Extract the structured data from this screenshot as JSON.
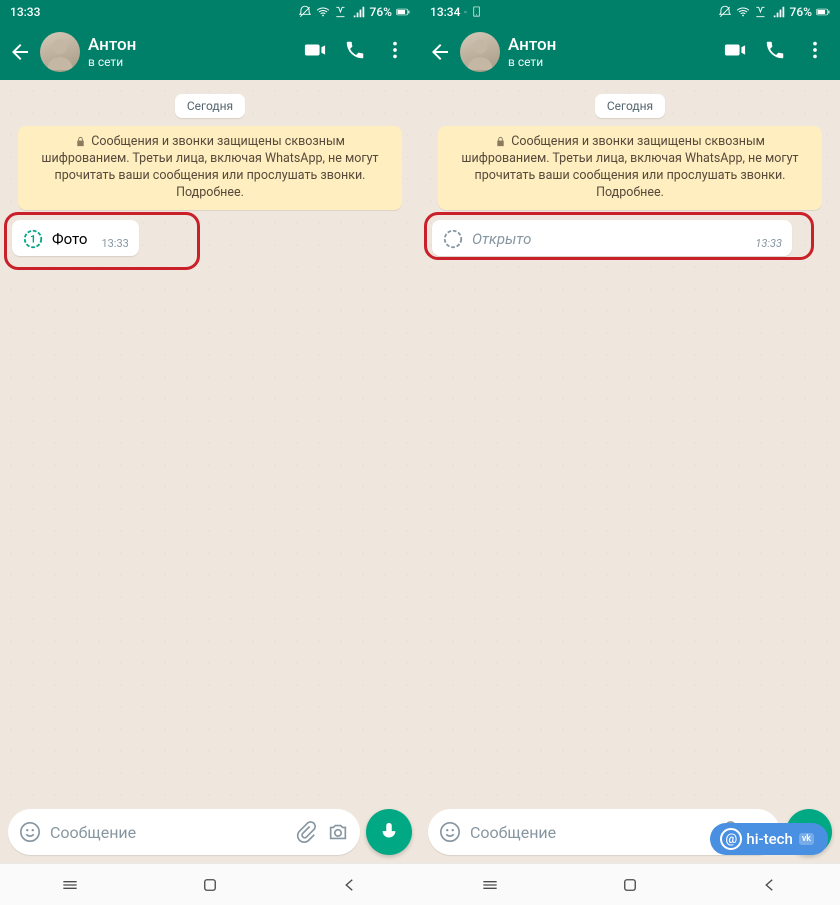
{
  "screens": [
    {
      "status": {
        "time": "13:33",
        "battery_text": "76%"
      },
      "header": {
        "name": "Антон",
        "status": "в сети"
      },
      "date_label": "Сегодня",
      "e2e_notice": "Сообщения и звонки защищены сквозным шифрованием. Третьи лица, включая WhatsApp, не могут прочитать ваши сообщения или прослушать звонки. Подробнее.",
      "message": {
        "type": "photo",
        "text": "Фото",
        "time": "13:33",
        "opened": false
      },
      "input_placeholder": "Сообщение"
    },
    {
      "status": {
        "time": "13:34",
        "battery_text": "76%"
      },
      "header": {
        "name": "Антон",
        "status": "в сети"
      },
      "date_label": "Сегодня",
      "e2e_notice": "Сообщения и звонки защищены сквозным шифрованием. Третьи лица, включая WhatsApp, не могут прочитать ваши сообщения или прослушать звонки. Подробнее.",
      "message": {
        "type": "opened",
        "text": "Открыто",
        "time": "13:33",
        "opened": true
      },
      "input_placeholder": "Сообщение"
    }
  ],
  "watermark": {
    "text": "hi-tech",
    "at": "@",
    "vk": "vk"
  }
}
